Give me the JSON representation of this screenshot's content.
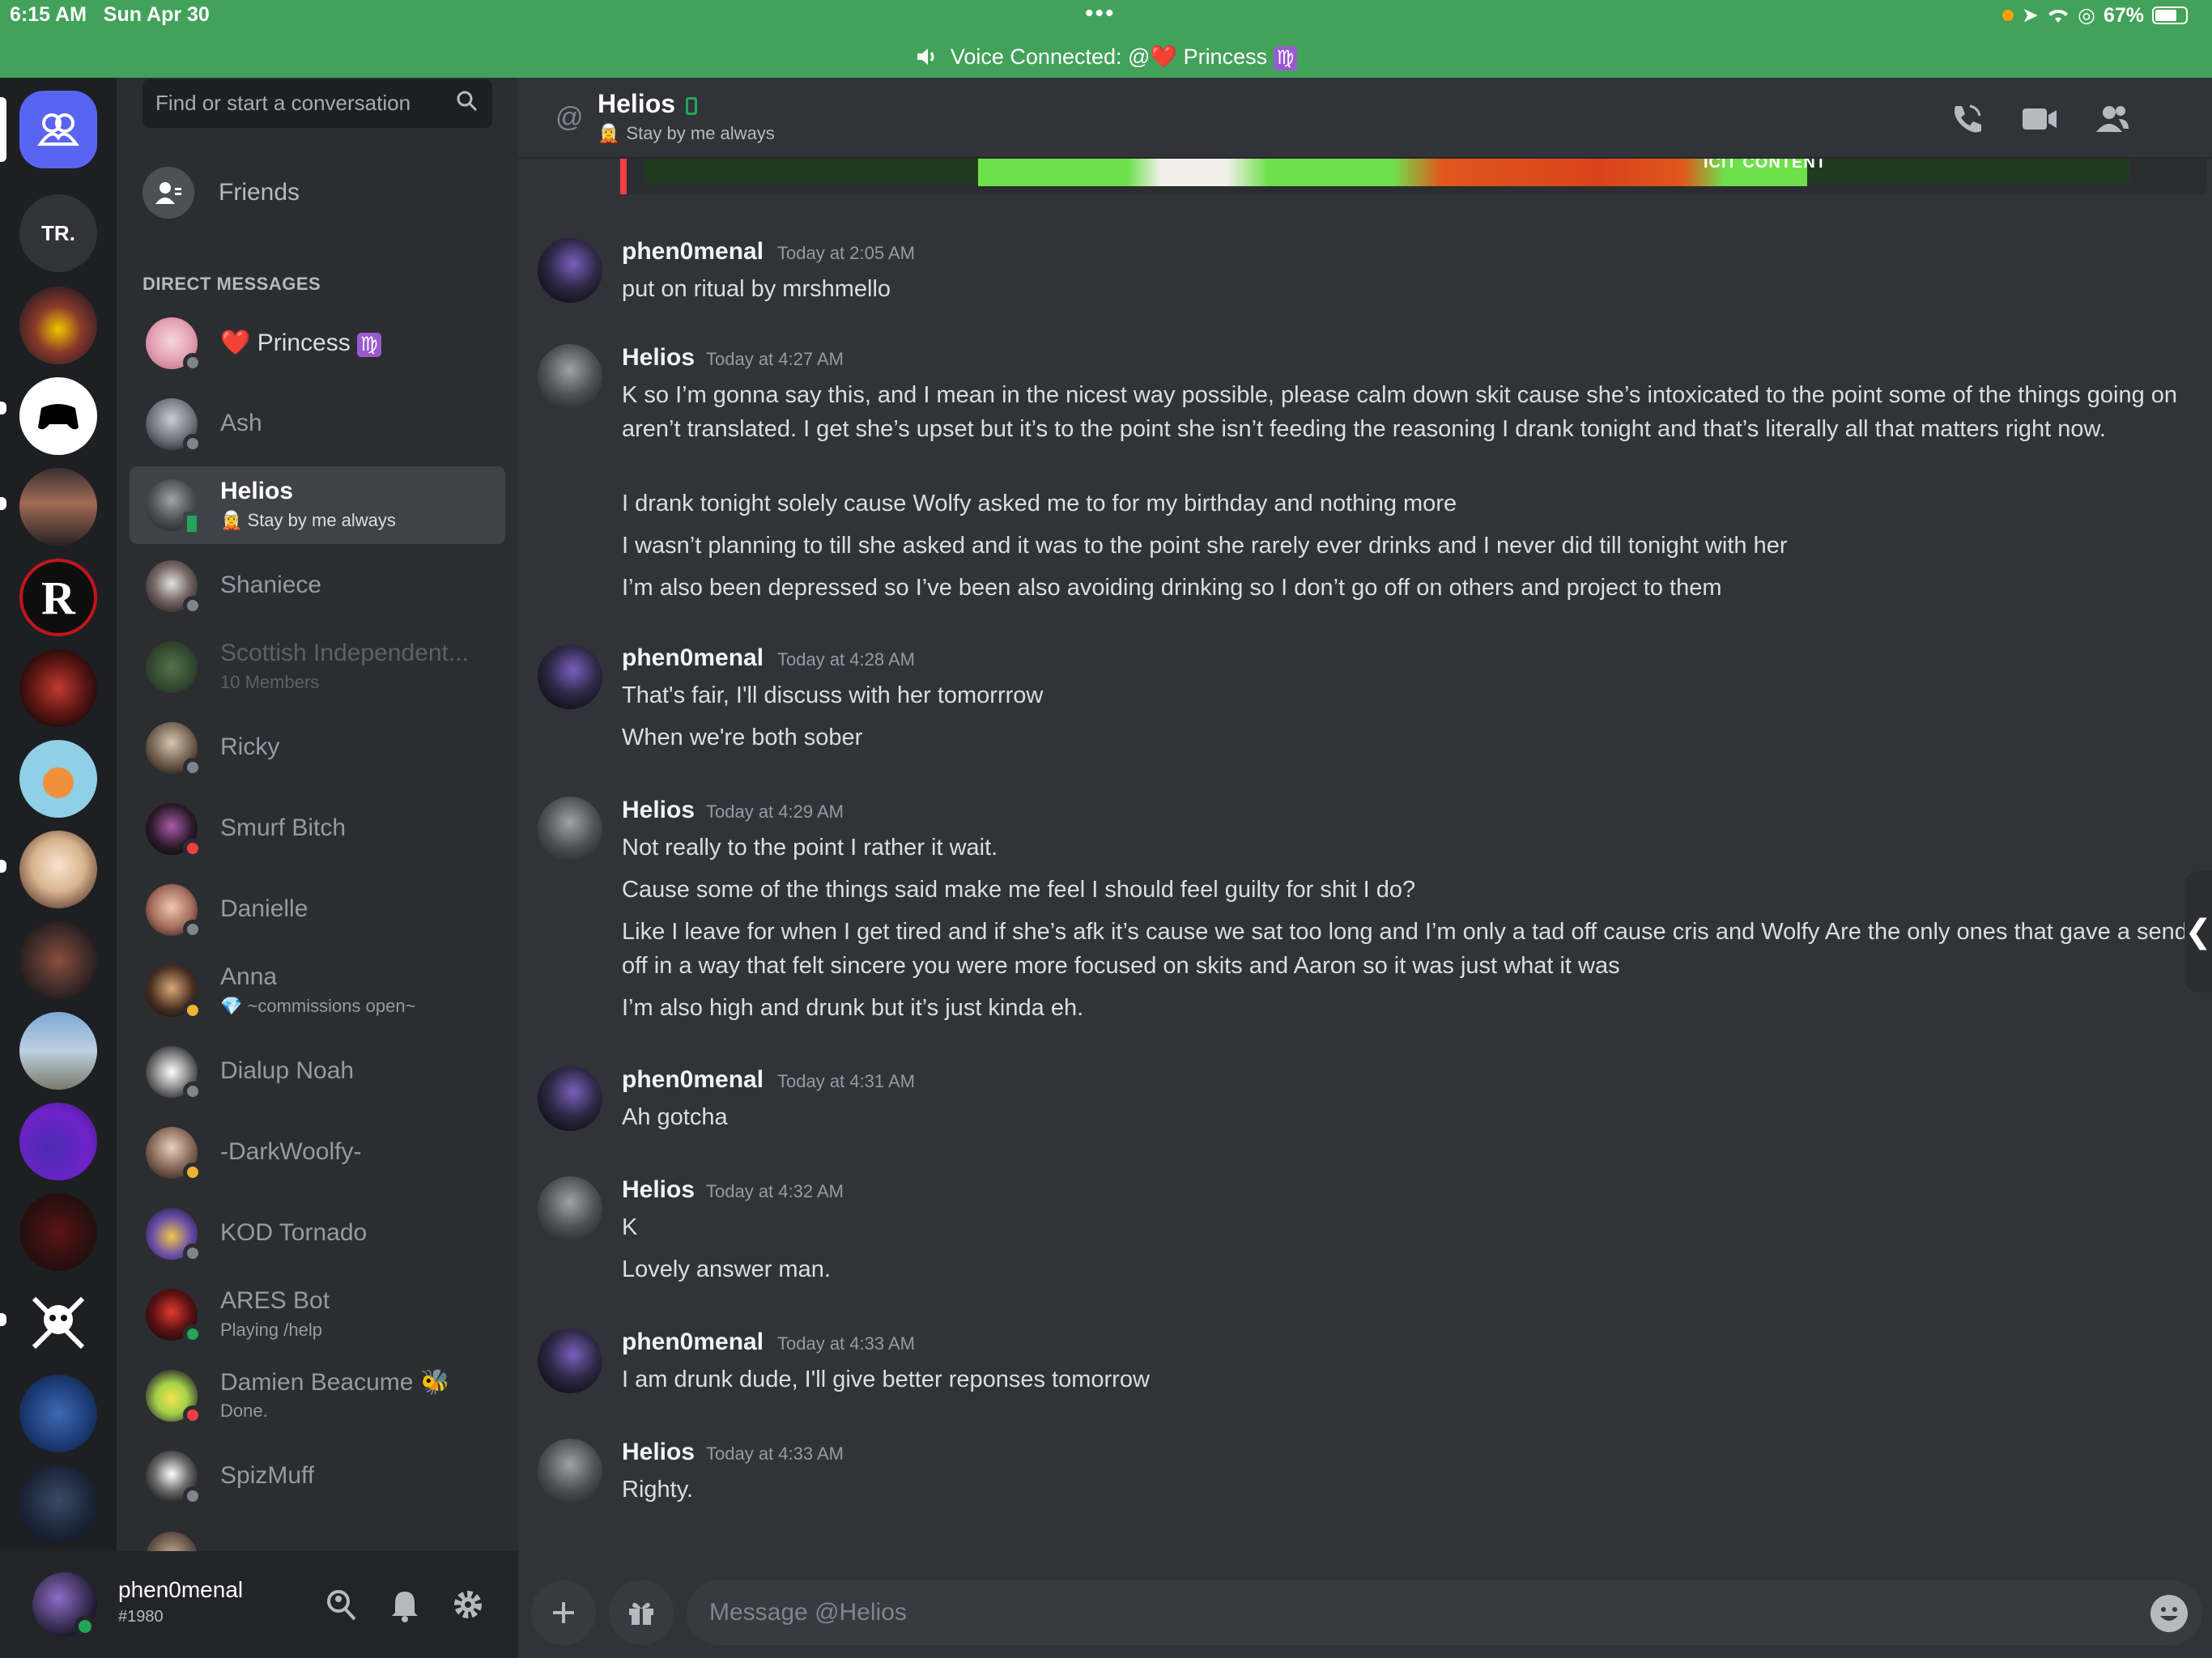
{
  "status_bar": {
    "time": "6:15 AM",
    "date": "Sun Apr 30",
    "battery": "67%"
  },
  "voice": {
    "prefix": "Voice Connected: @",
    "heart": "❤️",
    "name": "Princess",
    "zodiac": "♍"
  },
  "servers": [
    {
      "label": "",
      "name": "dm-home"
    },
    {
      "label": "TR.",
      "name": "tr"
    },
    {
      "label": "",
      "name": "server"
    },
    {
      "label": "",
      "name": "server"
    },
    {
      "label": "",
      "name": "server"
    },
    {
      "label": "R",
      "name": "server-r"
    },
    {
      "label": "",
      "name": "server"
    },
    {
      "label": "",
      "name": "server"
    },
    {
      "label": "",
      "name": "server"
    },
    {
      "label": "",
      "name": "server"
    },
    {
      "label": "",
      "name": "server"
    },
    {
      "label": "",
      "name": "server"
    },
    {
      "label": "",
      "name": "server"
    },
    {
      "label": "",
      "name": "server"
    },
    {
      "label": "",
      "name": "server"
    },
    {
      "label": "",
      "name": "server"
    }
  ],
  "sidebar": {
    "search_placeholder": "Find or start a conversation",
    "friends_label": "Friends",
    "dm_header": "DIRECT MESSAGES",
    "dms": [
      {
        "name": "Princess",
        "heart": "❤️",
        "zodiac": "♍",
        "sub": "",
        "status": "offline"
      },
      {
        "name": "Ash",
        "sub": "",
        "status": "offline"
      },
      {
        "name": "Helios",
        "sub": "Stay by me always",
        "status": "mobile",
        "active": true
      },
      {
        "name": "Shaniece",
        "sub": "",
        "status": "offline"
      },
      {
        "name": "Scottish Independent...",
        "sub": "10 Members",
        "status": "none",
        "faded": true
      },
      {
        "name": "Ricky",
        "sub": "",
        "status": "offline"
      },
      {
        "name": "Smurf Bitch",
        "sub": "",
        "status": "dnd"
      },
      {
        "name": "Danielle",
        "sub": "",
        "status": "offline"
      },
      {
        "name": "Anna",
        "sub": "~commissions open~",
        "status": "idle"
      },
      {
        "name": "Dialup Noah",
        "sub": "",
        "status": "offline"
      },
      {
        "name": "-DarkWoolfy-",
        "sub": "",
        "status": "idle"
      },
      {
        "name": "KOD Tornado",
        "sub": "",
        "status": "offline"
      },
      {
        "name": "ARES Bot",
        "sub": "Playing /help",
        "status": "online"
      },
      {
        "name": "Damien Beacume",
        "bee": "🐝",
        "sub": "Done.",
        "status": "dnd"
      },
      {
        "name": "SpizMuff",
        "sub": "",
        "status": "offline"
      }
    ]
  },
  "user": {
    "name": "phen0menal",
    "tag": "#1980"
  },
  "chat": {
    "at": "@",
    "title": "Helios",
    "subtitle": "Stay by me always",
    "composer_placeholder": "Message @Helios"
  },
  "messages": [
    {
      "author": "phen0menal",
      "time": "Today at 2:05 AM",
      "lines": [
        "put on ritual by mrshmello"
      ]
    },
    {
      "author": "Helios",
      "time": "Today at 4:27 AM",
      "lines": [
        "K so I’m gonna say this, and I mean in the nicest way possible, please calm down skit cause she’s intoxicated to the point some of the things going on aren’t translated. I get she’s upset but it’s to the point she isn’t feeding the reasoning I drank tonight and that’s literally all that matters right now.",
        "I drank tonight solely cause Wolfy asked me to for my birthday and nothing more",
        "I wasn’t planning to till she asked and it was to the point she rarely ever drinks and I never did till tonight with her",
        "I’m also been depressed so I’ve been also avoiding drinking so I don’t go off on others and project to them"
      ]
    },
    {
      "author": "phen0menal",
      "time": "Today at 4:28 AM",
      "lines": [
        "That's fair, I'll discuss with her tomorrrow",
        "When we're both sober"
      ]
    },
    {
      "author": "Helios",
      "time": "Today at 4:29 AM",
      "lines": [
        "Not really to the point I rather it wait.",
        "Cause some of the things said make me feel I should feel guilty for shit I do?",
        "Like I leave for when I get tired and if she’s afk it’s cause we sat too long and I’m only a tad off cause cris and Wolfy Are the only ones that gave a send off in a way that felt sincere you were more focused on skits and Aaron so it was just what it was",
        "I’m also high and drunk but it’s just kinda eh."
      ]
    },
    {
      "author": "phen0menal",
      "time": "Today at 4:31 AM",
      "lines": [
        "Ah gotcha"
      ]
    },
    {
      "author": "Helios",
      "time": "Today at 4:32 AM",
      "lines": [
        "K",
        "Lovely answer man."
      ]
    },
    {
      "author": "phen0menal",
      "time": "Today at 4:33 AM",
      "lines": [
        "I am drunk dude, I'll give better reponses tomorrow"
      ]
    },
    {
      "author": "Helios",
      "time": "Today at 4:33 AM",
      "lines": [
        "Righty."
      ]
    }
  ],
  "embed_text": "ICIT CONTENT",
  "colors": {
    "accent": "#5865f2",
    "voice_banner": "#43a25a",
    "online": "#23a55a",
    "dnd": "#f23f43",
    "idle": "#f0b232"
  }
}
